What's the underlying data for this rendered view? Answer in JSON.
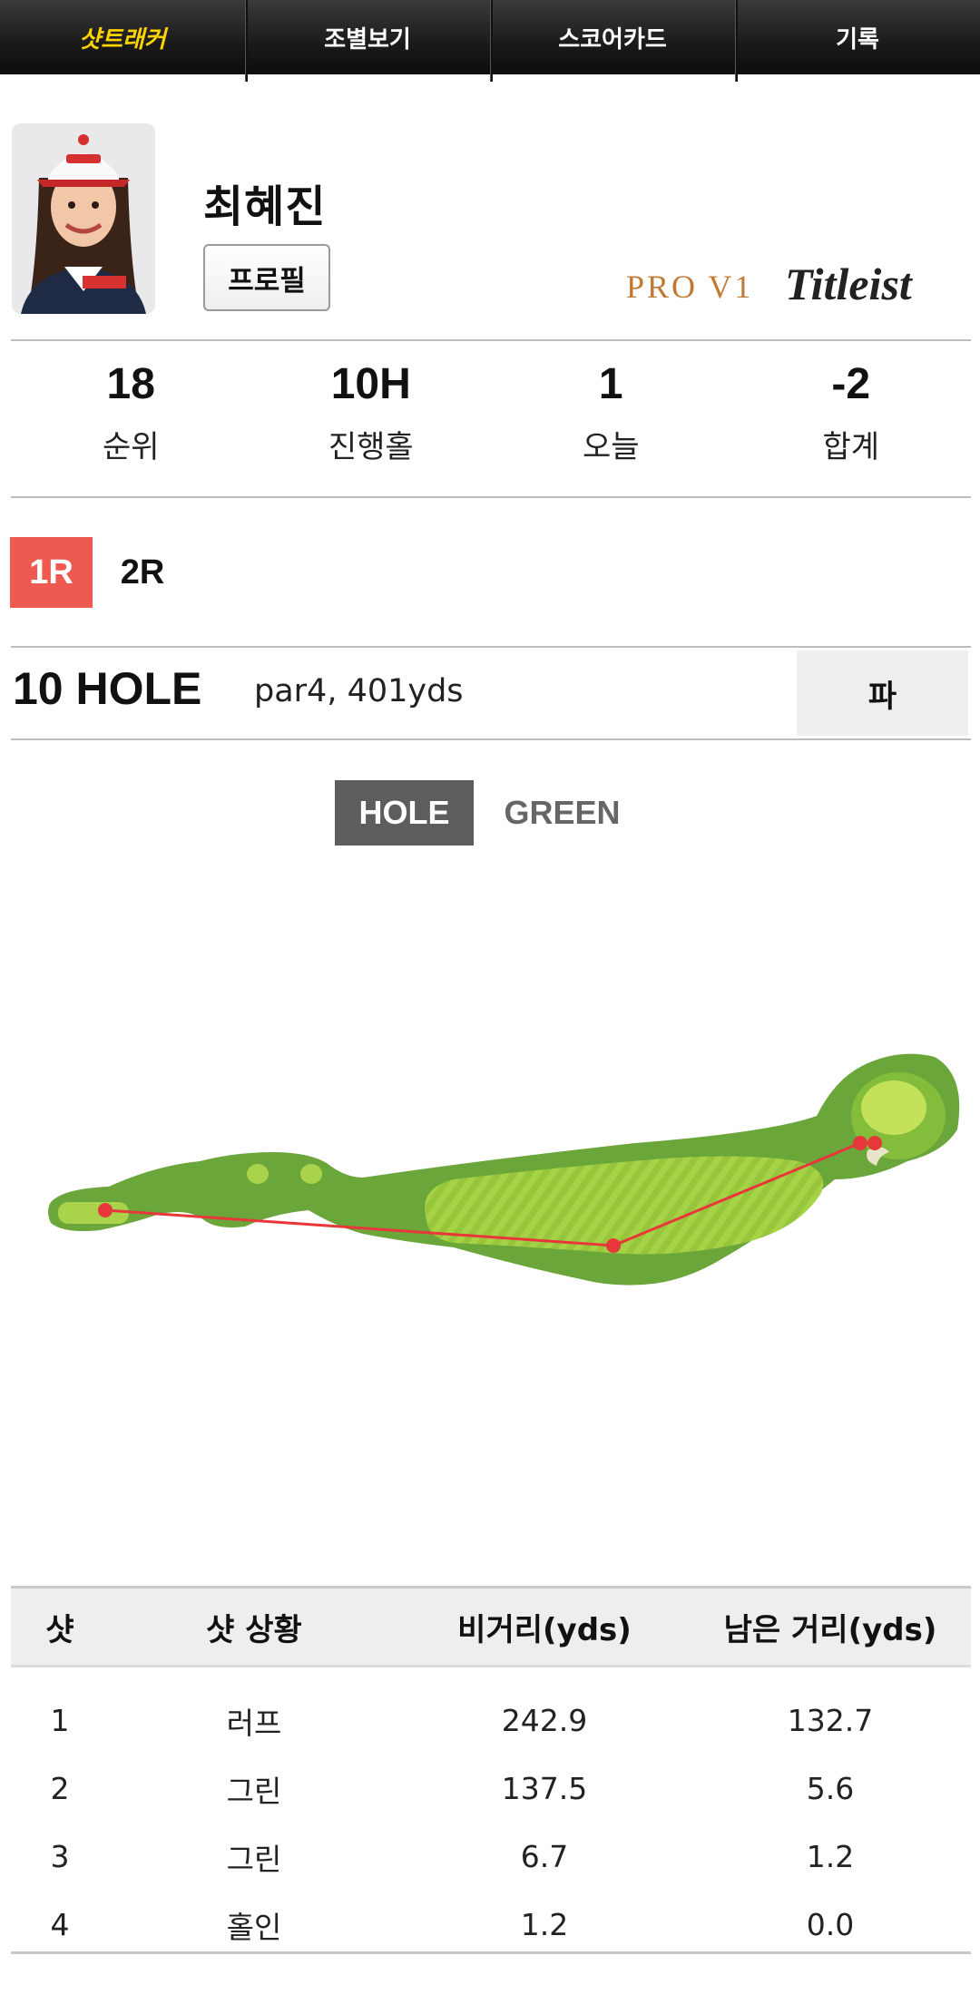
{
  "tabs": [
    {
      "label": "샷트래커",
      "active": true
    },
    {
      "label": "조별보기",
      "active": false
    },
    {
      "label": "스코어카드",
      "active": false
    },
    {
      "label": "기록",
      "active": false
    }
  ],
  "player": {
    "name": "최혜진",
    "profile_button": "프로필"
  },
  "sponsor": {
    "pro_v1": "PRO V1",
    "titleist": "Titleist"
  },
  "stats": [
    {
      "value": "18",
      "label": "순위"
    },
    {
      "value": "10H",
      "label": "진행홀"
    },
    {
      "value": "1",
      "label": "오늘"
    },
    {
      "value": "-2",
      "label": "합계"
    }
  ],
  "rounds": [
    {
      "label": "1R",
      "active": true
    },
    {
      "label": "2R",
      "active": false
    }
  ],
  "hole": {
    "title": "10 HOLE",
    "info": "par4, 401yds",
    "result": "파"
  },
  "view_toggle": {
    "hole": "HOLE",
    "green": "GREEN",
    "selected": "HOLE"
  },
  "shot_table": {
    "headers": [
      "샷",
      "샷 상황",
      "비거리(yds)",
      "남은 거리(yds)"
    ],
    "rows": [
      [
        "1",
        "러프",
        "242.9",
        "132.7"
      ],
      [
        "2",
        "그린",
        "137.5",
        "5.6"
      ],
      [
        "3",
        "그린",
        "6.7",
        "1.2"
      ],
      [
        "4",
        "홀인",
        "1.2",
        "0.0"
      ]
    ]
  },
  "colors": {
    "active_tab": "#ffd400",
    "active_round": "#ef5a50",
    "shot_line": "#e8373a",
    "fairway": "#6aa63a",
    "green": "#b8dc4a"
  }
}
